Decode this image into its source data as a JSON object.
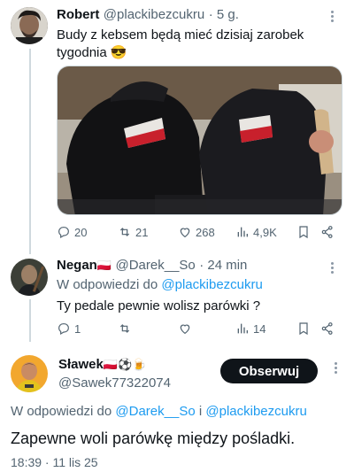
{
  "tweet1": {
    "name": "Robert",
    "handle": "@plackibezcukru",
    "time": "· 5 g.",
    "text_line1": "Budy z kebsem będą mieć dzisiaj zarobek",
    "text_line2": "tygodnia",
    "emoji": "😎",
    "stats": {
      "replies": "20",
      "retweets": "21",
      "likes": "268",
      "views": "4,9K"
    }
  },
  "tweet2": {
    "name": "Negan",
    "flag": "🇵🇱",
    "handle": "@Darek__So",
    "time": "· 24 min",
    "reply_prefix": "W odpowiedzi do",
    "reply_to": "@plackibezcukru",
    "text": "Ty pedale pewnie wolisz parówki ?",
    "stats": {
      "replies": "1",
      "retweets": "",
      "likes": "",
      "views": "14"
    }
  },
  "tweet3": {
    "name": "Sławek",
    "badges": "🇵🇱⚽🍺",
    "handle": "@Sawek77322074",
    "follow_label": "Obserwuj",
    "reply_prefix": "W odpowiedzi do",
    "reply_to_1": "@Darek__So",
    "reply_and": "i",
    "reply_to_2": "@plackibezcukru",
    "text": "Zapewne woli parówkę między pośladki.",
    "timestamp": "18:39 · 11 lis 25"
  },
  "colors": {
    "link": "#1d9bf0",
    "muted": "#536471",
    "button": "#0f1419"
  }
}
